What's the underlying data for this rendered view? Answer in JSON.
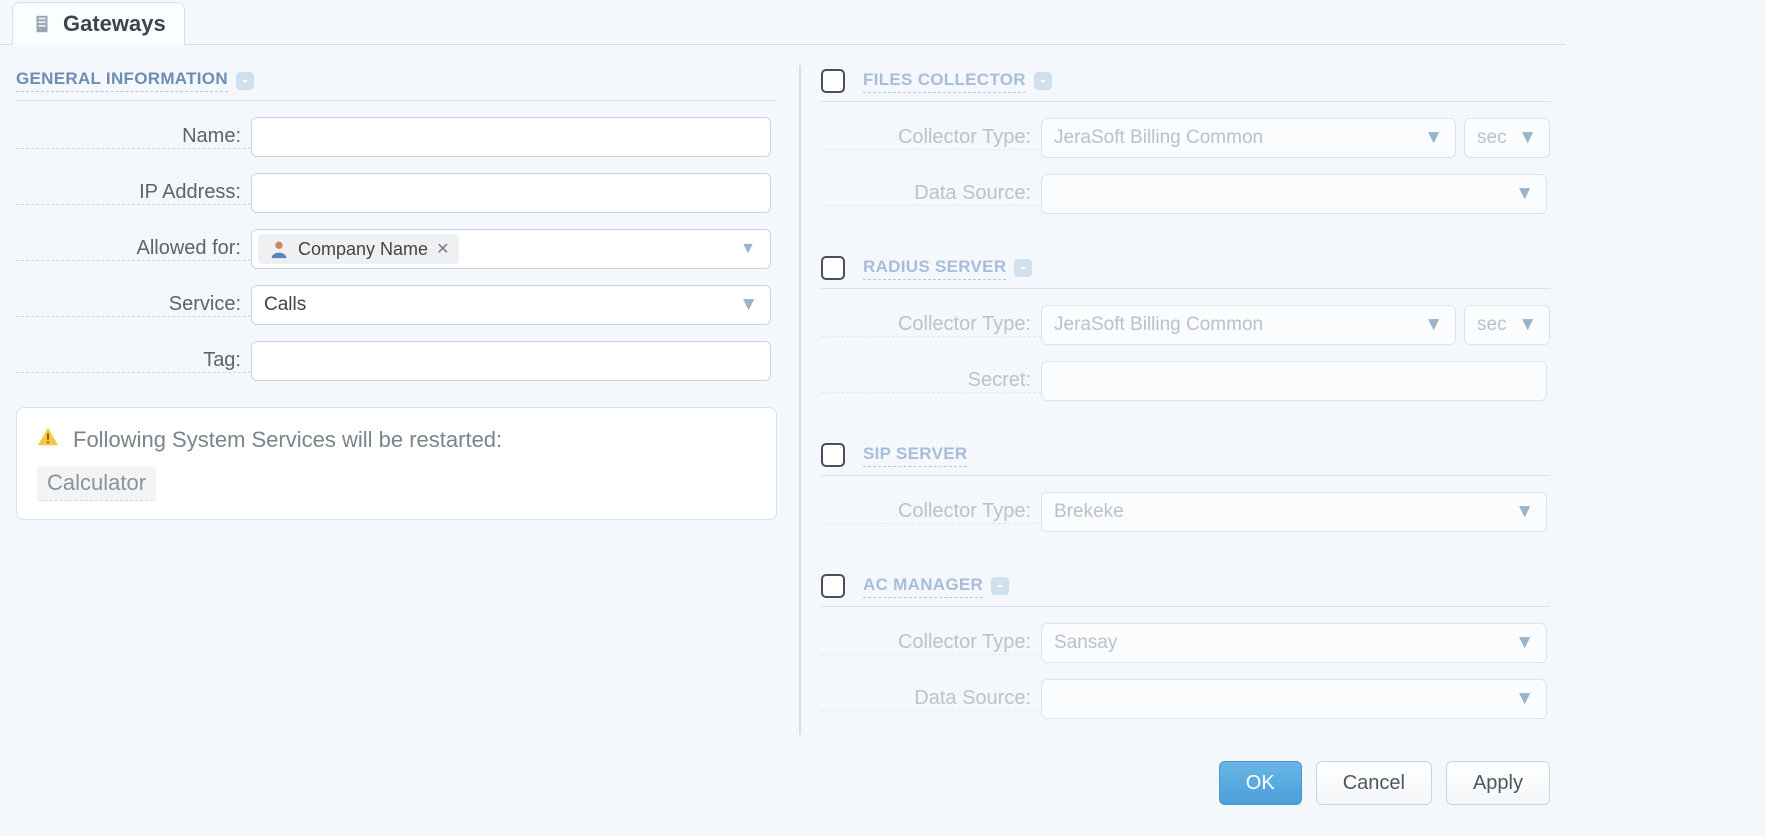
{
  "tab": {
    "title": "Gateways"
  },
  "left": {
    "section_title": "GENERAL INFORMATION",
    "labels": {
      "name": "Name:",
      "ip": "IP Address:",
      "allowed": "Allowed for:",
      "service": "Service:",
      "tag": "Tag:"
    },
    "values": {
      "name": "",
      "ip": "",
      "service": "Calls",
      "tag": ""
    },
    "chips": {
      "company": "Company Name"
    },
    "warn_text": "Following System Services will be restarted:",
    "warn_badge": "Calculator"
  },
  "right": {
    "sections": {
      "files": {
        "title": "FILES COLLECTOR",
        "collector_label": "Collector Type:",
        "collector_value": "JeraSoft Billing Common",
        "unit": "sec",
        "ds_label": "Data Source:",
        "ds_value": ""
      },
      "radius": {
        "title": "RADIUS SERVER",
        "collector_label": "Collector Type:",
        "collector_value": "JeraSoft Billing Common",
        "unit": "sec",
        "secret_label": "Secret:",
        "secret_value": ""
      },
      "sip": {
        "title": "SIP SERVER",
        "collector_label": "Collector Type:",
        "collector_value": "Brekeke"
      },
      "ac": {
        "title": "AC MANAGER",
        "collector_label": "Collector Type:",
        "collector_value": "Sansay",
        "ds_label": "Data Source:",
        "ds_value": ""
      }
    }
  },
  "footer": {
    "ok": "OK",
    "cancel": "Cancel",
    "apply": "Apply"
  }
}
